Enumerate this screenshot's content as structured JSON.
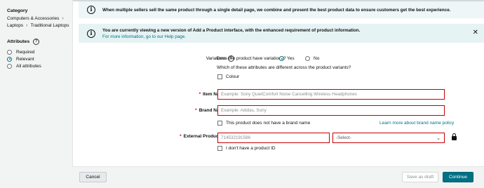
{
  "sidebar": {
    "category_heading": "Category",
    "breadcrumbs": [
      "Computers & Accessories",
      "Laptops",
      "Traditional Laptops"
    ],
    "attributes_heading": "Attributes",
    "attribute_options": [
      {
        "label": "Required",
        "selected": false
      },
      {
        "label": "Relevant",
        "selected": true
      },
      {
        "label": "All attributes",
        "selected": false
      }
    ]
  },
  "banners": {
    "sellers_notice": "When multiple sellers sell the same product through a single detail page, we combine and present the best product data to ensure customers get the best experience.",
    "version_notice": "You are currently viewing a new version of Add a Product interface, with the enhanced requirement of product information.",
    "help_link": "For more information, go to our Help page."
  },
  "form": {
    "variations": {
      "label": "Variations",
      "question": "Does the product have variations?",
      "yes_label": "Yes",
      "no_label": "No",
      "selected": "Yes",
      "attributes_question": "Which of these attributes are different across the product variants?",
      "colour_label": "Colour"
    },
    "item_name": {
      "label": "Item Name",
      "placeholder": "Example: Sony QuietComfort Noise Cancelling Wireless Headphones",
      "value": ""
    },
    "brand_name": {
      "label": "Brand Name",
      "placeholder": "Example: Adidas, Sony",
      "value": "",
      "no_brand_label": "This product does not have a brand name",
      "learn_more_link": "Learn more about brand name policy"
    },
    "external_product_id": {
      "label": "External Product ID",
      "value": "714532191586",
      "type_selected": "-Select-",
      "no_id_label": "I don't have a product ID"
    },
    "required_marker": "*"
  },
  "footer": {
    "cancel_label": "Cancel",
    "save_draft_label": "Save as draft",
    "continue_label": "Continue"
  },
  "colors": {
    "accent": "#007185",
    "error_border": "#c40000",
    "banner_bg": "#e6f3f4"
  }
}
